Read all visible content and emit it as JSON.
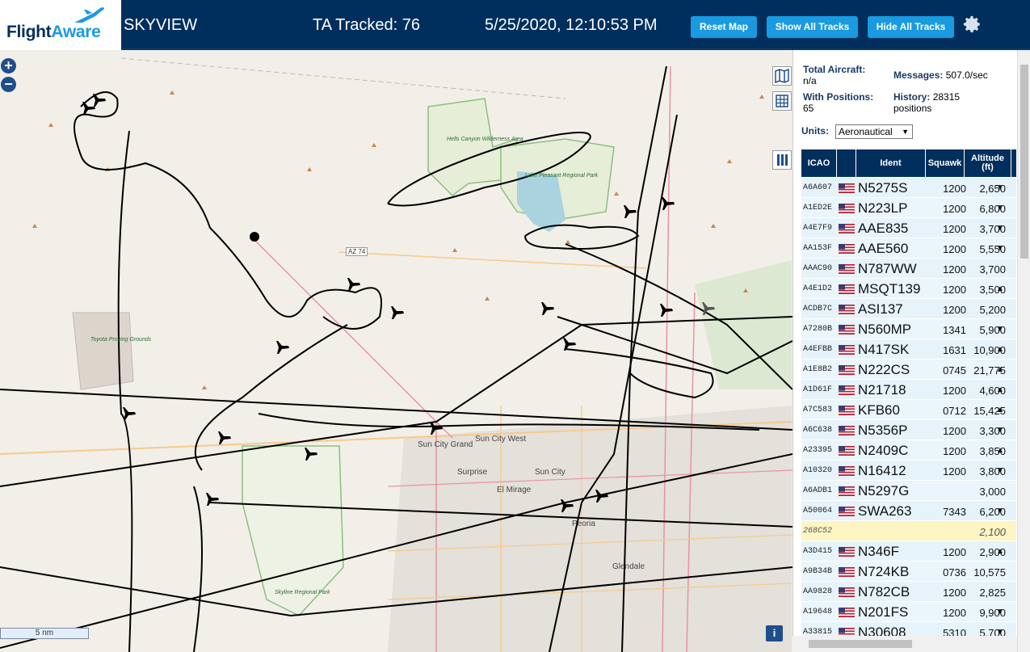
{
  "header": {
    "logo_text_part1": "Flight",
    "logo_text_part2": "Aware",
    "app_title": "SKYVIEW",
    "tracked_label": "TA Tracked: 76",
    "datetime": "5/25/2020, 12:10:53 PM",
    "buttons": {
      "reset": "Reset Map",
      "show_all": "Show All Tracks",
      "hide_all": "Hide All Tracks"
    },
    "settings_icon": "gear-icon"
  },
  "map": {
    "zoom_in": "+",
    "zoom_out": "−",
    "scale_label": "5 nm",
    "info_label": "i",
    "labels": {
      "hells_canyon": "Hells Canyon Wilderness Area",
      "lake_pleasant": "Lake Pleasant Regional Park",
      "toyota": "Toyota Proving Grounds",
      "skyline": "Skyline Regional Park",
      "sun_city_grand": "Sun City Grand",
      "sun_city_west": "Sun City West",
      "surprise": "Surprise",
      "sun_city": "Sun City",
      "el_mirage": "El Mirage",
      "peoria": "Peoria",
      "glendale": "Glendale",
      "az74": "AZ 74"
    },
    "colors": {
      "land": "#f2efe9",
      "park_border": "#8cbf7e",
      "lake": "#aad3df",
      "road_primary": "#e892a2",
      "road_secondary": "#f7c98b",
      "track": "#000000"
    }
  },
  "panel": {
    "stats": {
      "total_aircraft_label": "Total Aircraft:",
      "total_aircraft_value": "n/a",
      "messages_label": "Messages:",
      "messages_value": "507.0/sec",
      "with_positions_label": "With Positions:",
      "with_positions_value": "65",
      "history_label": "History:",
      "history_value": "28315",
      "history_unit": "positions"
    },
    "units_label": "Units:",
    "units_value": "Aeronautical",
    "columns": [
      "ICAO",
      "Ident",
      "Squawk",
      "Altitude (ft)"
    ],
    "rows": [
      {
        "icao": "A6A607",
        "ident": "N5275S",
        "squawk": "1200",
        "altitude": "2,650",
        "trend": "▼"
      },
      {
        "icao": "A1ED2E",
        "ident": "N223LP",
        "squawk": "1200",
        "altitude": "6,800",
        "trend": "▼"
      },
      {
        "icao": "A4E7F9",
        "ident": "AAE835",
        "squawk": "1200",
        "altitude": "3,700",
        "trend": "▼"
      },
      {
        "icao": "AA153F",
        "ident": "AAE560",
        "squawk": "1200",
        "altitude": "5,550",
        "trend": "▼"
      },
      {
        "icao": "AAAC90",
        "ident": "N787WW",
        "squawk": "1200",
        "altitude": "3,700",
        "trend": ""
      },
      {
        "icao": "A4E1D2",
        "ident": "MSQT139",
        "squawk": "1200",
        "altitude": "3,500",
        "trend": "▲"
      },
      {
        "icao": "ACDB7C",
        "ident": "ASI137",
        "squawk": "1200",
        "altitude": "5,200",
        "trend": ""
      },
      {
        "icao": "A7280B",
        "ident": "N560MP",
        "squawk": "1341",
        "altitude": "5,900",
        "trend": "▼"
      },
      {
        "icao": "A4EFBB",
        "ident": "N417SK",
        "squawk": "1631",
        "altitude": "10,900",
        "trend": "▲"
      },
      {
        "icao": "A1E8B2",
        "ident": "N222CS",
        "squawk": "0745",
        "altitude": "21,775",
        "trend": "▲"
      },
      {
        "icao": "A1D61F",
        "ident": "N21718",
        "squawk": "1200",
        "altitude": "4,600",
        "trend": "▲"
      },
      {
        "icao": "A7C583",
        "ident": "KFB60",
        "squawk": "0712",
        "altitude": "15,425",
        "trend": "▲"
      },
      {
        "icao": "A6C638",
        "ident": "N5356P",
        "squawk": "1200",
        "altitude": "3,300",
        "trend": "▼"
      },
      {
        "icao": "A23395",
        "ident": "N2409C",
        "squawk": "1200",
        "altitude": "3,850",
        "trend": "▲"
      },
      {
        "icao": "A10320",
        "ident": "N16412",
        "squawk": "1200",
        "altitude": "3,800",
        "trend": "▼"
      },
      {
        "icao": "A6ADB1",
        "ident": "N5297G",
        "squawk": "",
        "altitude": "3,000",
        "trend": ""
      },
      {
        "icao": "A50064",
        "ident": "SWA263",
        "squawk": "7343",
        "altitude": "6,200",
        "trend": "▼"
      },
      {
        "icao": "268C52",
        "ident": "",
        "squawk": "",
        "altitude": "2,100",
        "trend": "",
        "highlight": true
      },
      {
        "icao": "A3D415",
        "ident": "N346F",
        "squawk": "1200",
        "altitude": "2,900",
        "trend": "▲"
      },
      {
        "icao": "A9B34B",
        "ident": "N724KB",
        "squawk": "0736",
        "altitude": "10,575",
        "trend": ""
      },
      {
        "icao": "AA9828",
        "ident": "N782CB",
        "squawk": "1200",
        "altitude": "2,825",
        "trend": ""
      },
      {
        "icao": "A19648",
        "ident": "N201FS",
        "squawk": "1200",
        "altitude": "9,900",
        "trend": "▼"
      },
      {
        "icao": "A33815",
        "ident": "N30608",
        "squawk": "5310",
        "altitude": "5,700",
        "trend": "▼"
      }
    ]
  }
}
